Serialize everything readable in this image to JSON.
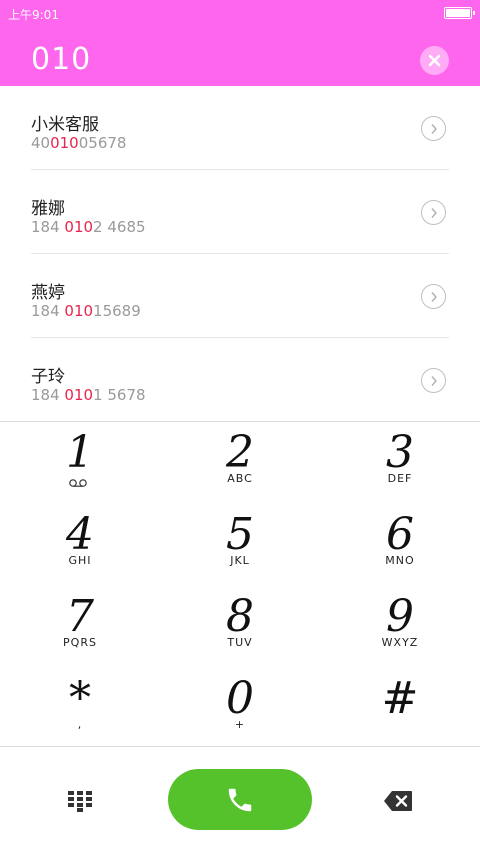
{
  "status_bar": {
    "time": "上午9:01",
    "battery_level": 1.0
  },
  "dialer": {
    "input": "010"
  },
  "contacts": [
    {
      "name": "小米客服",
      "number_pre": "40",
      "number_match": "010",
      "number_post": "05678"
    },
    {
      "name": "雅娜",
      "number_pre": "184 ",
      "number_match": "010",
      "number_post": "2 4685"
    },
    {
      "name": "燕婷",
      "number_pre": "184 ",
      "number_match": "010",
      "number_post": "15689"
    },
    {
      "name": "子玲",
      "number_pre": "184 ",
      "number_match": "010",
      "number_post": "1 5678"
    }
  ],
  "keypad": [
    {
      "digit": "1",
      "letters": ""
    },
    {
      "digit": "2",
      "letters": "ABC"
    },
    {
      "digit": "3",
      "letters": "DEF"
    },
    {
      "digit": "4",
      "letters": "GHI"
    },
    {
      "digit": "5",
      "letters": "JKL"
    },
    {
      "digit": "6",
      "letters": "MNO"
    },
    {
      "digit": "7",
      "letters": "PQRS"
    },
    {
      "digit": "8",
      "letters": "TUV"
    },
    {
      "digit": "9",
      "letters": "WXYZ"
    },
    {
      "digit": "*",
      "letters": ","
    },
    {
      "digit": "0",
      "letters": "+"
    },
    {
      "digit": "#",
      "letters": ""
    }
  ],
  "icons": {
    "clear": "close-icon",
    "row_action": "chevron-right-icon",
    "key_1_sub": "voicemail-icon",
    "dialpad": "dialpad-icon",
    "call": "phone-icon",
    "backspace": "backspace-icon"
  },
  "colors": {
    "header": "#ff66ee",
    "highlight": "#e8254c",
    "call_button": "#55c22c"
  }
}
